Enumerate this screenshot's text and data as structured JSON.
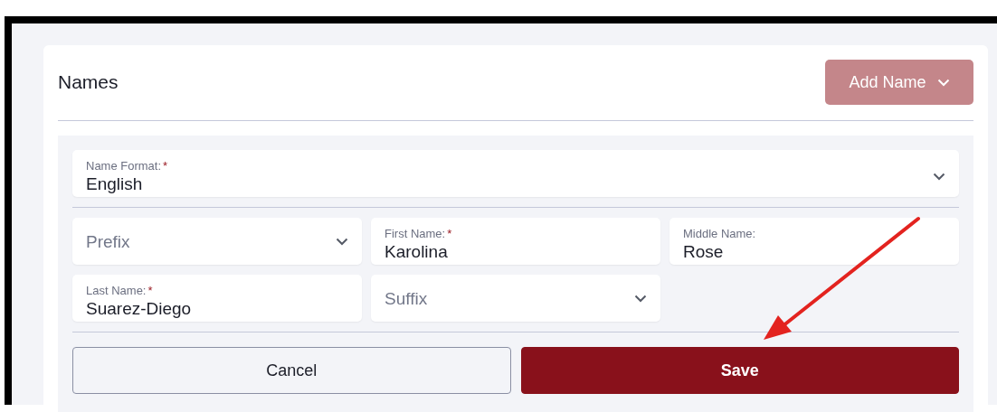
{
  "header": {
    "title": "Names",
    "add_button": {
      "label": "Add Name"
    }
  },
  "name_format": {
    "kind": "select",
    "label": "Name Format:",
    "marker": "*",
    "value": "English"
  },
  "fields": [
    {
      "kind": "select",
      "placeholder": "Prefix"
    },
    {
      "kind": "text",
      "label": "First Name:",
      "marker": "*",
      "value": "Karolina"
    },
    {
      "kind": "text",
      "label": "Middle Name:",
      "value": "Rose"
    },
    {
      "kind": "text",
      "label": "Last Name:",
      "marker": "*",
      "value": "Suarez-Diego"
    },
    {
      "kind": "select",
      "placeholder": "Suffix"
    }
  ],
  "buttons": [
    {
      "kind": "secondary",
      "label": "Cancel"
    },
    {
      "kind": "primary",
      "label": "Save"
    }
  ]
}
